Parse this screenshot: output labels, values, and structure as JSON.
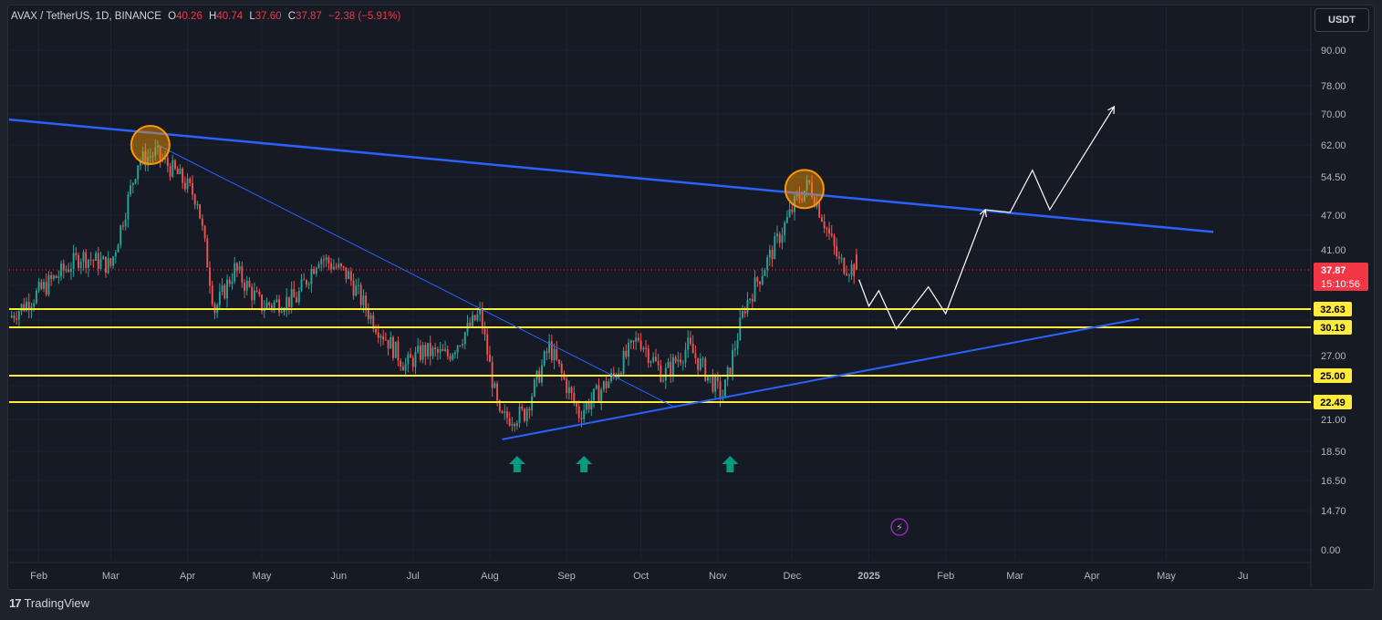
{
  "header": {
    "symbol": "AVAX / TetherUS, 1D, BINANCE",
    "o_label": "O",
    "o_value": "40.26",
    "h_label": "H",
    "h_value": "40.74",
    "l_label": "L",
    "l_value": "37.60",
    "c_label": "C",
    "c_value": "37.87",
    "change": "−2.38 (−5.91%)"
  },
  "currency_button": "USDT",
  "branding": "TradingView",
  "colors": {
    "background": "#161a25",
    "up": "#26a69a",
    "down": "#ef5350",
    "trendline": "#2962ff",
    "support": "#ffeb3b",
    "highlight": "#ff9800",
    "marker": "#089981",
    "price_tag": "#f23645"
  },
  "chart_data": {
    "type": "candlestick",
    "symbol": "AVAX / TetherUS",
    "interval": "1D",
    "exchange": "BINANCE",
    "y_scale": "log",
    "y_ticks": [
      90.0,
      78.0,
      70.0,
      62.0,
      54.5,
      47.0,
      41.0,
      32.63,
      30.19,
      27.0,
      25.0,
      22.49,
      21.0,
      18.5,
      16.5,
      14.7,
      0.0
    ],
    "y_tick_labels": [
      "90.00",
      "78.00",
      "70.00",
      "62.00",
      "54.50",
      "47.00",
      "41.00",
      "32.63",
      "30.19",
      "27.00",
      "25.00",
      "22.49",
      "21.00",
      "18.50",
      "16.50",
      "14.70",
      "0.00"
    ],
    "x_ticks": [
      "Feb",
      "Mar",
      "Apr",
      "May",
      "Jun",
      "Jul",
      "Aug",
      "Sep",
      "Oct",
      "Nov",
      "Dec",
      "2025",
      "Feb",
      "Mar",
      "Apr",
      "May",
      "Ju"
    ],
    "last_price": "37.87",
    "countdown": "15:10:56",
    "ohlc_last": {
      "open": 40.26,
      "high": 40.74,
      "low": 37.6,
      "close": 37.87,
      "change": -2.38,
      "change_pct": -5.91
    },
    "support_levels": [
      {
        "label": "32.63",
        "value": 32.63
      },
      {
        "label": "30.19",
        "value": 30.19
      },
      {
        "label": "25.00",
        "value": 25.0
      },
      {
        "label": "22.49",
        "value": 22.49
      }
    ],
    "price_path": [
      {
        "date": "2024-01-20",
        "close": 31.5
      },
      {
        "date": "2024-02-05",
        "close": 36.0
      },
      {
        "date": "2024-02-18",
        "close": 40.0
      },
      {
        "date": "2024-03-01",
        "close": 38.5
      },
      {
        "date": "2024-03-12",
        "close": 58.0
      },
      {
        "date": "2024-03-19",
        "close": 60.0
      },
      {
        "date": "2024-03-28",
        "close": 55.0
      },
      {
        "date": "2024-04-05",
        "close": 50.0
      },
      {
        "date": "2024-04-12",
        "close": 32.5
      },
      {
        "date": "2024-04-20",
        "close": 38.0
      },
      {
        "date": "2024-05-01",
        "close": 33.0
      },
      {
        "date": "2024-05-15",
        "close": 34.0
      },
      {
        "date": "2024-05-24",
        "close": 40.0
      },
      {
        "date": "2024-06-05",
        "close": 37.0
      },
      {
        "date": "2024-06-15",
        "close": 31.0
      },
      {
        "date": "2024-06-28",
        "close": 26.0
      },
      {
        "date": "2024-07-05",
        "close": 27.5
      },
      {
        "date": "2024-07-15",
        "close": 27.0
      },
      {
        "date": "2024-07-28",
        "close": 32.0
      },
      {
        "date": "2024-08-05",
        "close": 21.0
      },
      {
        "date": "2024-08-15",
        "close": 21.5
      },
      {
        "date": "2024-08-25",
        "close": 28.0
      },
      {
        "date": "2024-09-06",
        "close": 21.5
      },
      {
        "date": "2024-09-20",
        "close": 25.0
      },
      {
        "date": "2024-09-30",
        "close": 29.0
      },
      {
        "date": "2024-10-10",
        "close": 25.0
      },
      {
        "date": "2024-10-20",
        "close": 28.0
      },
      {
        "date": "2024-11-03",
        "close": 23.0
      },
      {
        "date": "2024-11-12",
        "close": 33.0
      },
      {
        "date": "2024-11-22",
        "close": 40.0
      },
      {
        "date": "2024-12-03",
        "close": 50.0
      },
      {
        "date": "2024-12-08",
        "close": 53.0
      },
      {
        "date": "2024-12-13",
        "close": 47.0
      },
      {
        "date": "2024-12-20",
        "close": 39.0
      },
      {
        "date": "2024-12-27",
        "close": 37.87
      }
    ],
    "descending_trendline": [
      {
        "date": "2024-01-20",
        "price": 68.5
      },
      {
        "date": "2025-05-20",
        "price": 44.0
      }
    ],
    "second_trendline": [
      {
        "date": "2024-03-20",
        "price": 62.0
      },
      {
        "date": "2024-10-15",
        "price": 22.0
      }
    ],
    "ascending_trendline": [
      {
        "date": "2024-08-06",
        "price": 19.4
      },
      {
        "date": "2025-04-20",
        "price": 31.3
      }
    ],
    "highlighted_tops": [
      {
        "date": "2024-03-17",
        "price": 62.0
      },
      {
        "date": "2024-12-06",
        "price": 52.0
      }
    ],
    "bounce_markers": [
      "2024-08-12",
      "2024-09-08",
      "2024-11-06"
    ],
    "projection_path": [
      {
        "date": "2024-12-28",
        "price": 36.5
      },
      {
        "date": "2025-01-01",
        "price": 33.0
      },
      {
        "date": "2025-01-05",
        "price": 35.0
      },
      {
        "date": "2025-01-12",
        "price": 30.0
      },
      {
        "date": "2025-01-25",
        "price": 35.5
      },
      {
        "date": "2025-02-01",
        "price": 32.0
      },
      {
        "date": "2025-02-17",
        "price": 48.0
      },
      {
        "date": "2025-02-27",
        "price": 47.5
      },
      {
        "date": "2025-03-08",
        "price": 56.0
      },
      {
        "date": "2025-03-15",
        "price": 48.0
      },
      {
        "date": "2025-04-10",
        "price": 72.0
      }
    ]
  }
}
